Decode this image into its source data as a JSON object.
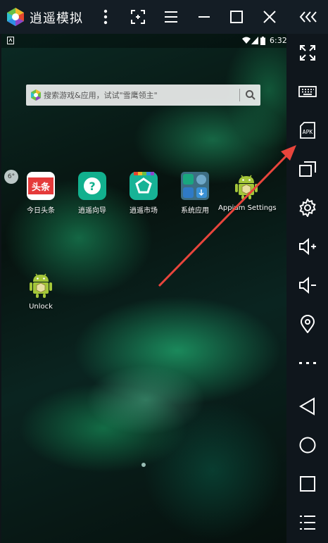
{
  "window": {
    "title": "逍遥模拟",
    "controls": [
      "menu-icon",
      "screenshot-icon",
      "list-icon",
      "minimize-icon",
      "maximize-icon",
      "close-icon",
      "collapse-icon"
    ]
  },
  "status_bar": {
    "time": "6:32",
    "icons": [
      "notification-icon",
      "wifi-icon",
      "signal-icon",
      "battery-icon"
    ]
  },
  "search": {
    "placeholder": "搜索游戏&应用，试试\"雪鹰领主\""
  },
  "weather": {
    "temperature": "6°"
  },
  "apps": [
    {
      "label": "今日头条",
      "icon_text": "头条",
      "icon": "toutiao-icon"
    },
    {
      "label": "逍遥向导",
      "icon_text": "?",
      "icon": "guide-icon"
    },
    {
      "label": "逍遥市场",
      "icon": "market-icon"
    },
    {
      "label": "系统应用",
      "icon": "system-apps-folder-icon"
    },
    {
      "label": "Appium Settings",
      "icon": "android-icon"
    },
    {
      "label": "Unlock",
      "icon": "android-icon"
    }
  ],
  "sidebar": {
    "buttons": [
      {
        "name": "fullscreen-icon"
      },
      {
        "name": "keyboard-icon"
      },
      {
        "name": "apk-install-icon",
        "label": "APK"
      },
      {
        "name": "multi-window-icon"
      },
      {
        "name": "settings-icon"
      },
      {
        "name": "volume-up-icon"
      },
      {
        "name": "volume-down-icon"
      },
      {
        "name": "location-icon"
      },
      {
        "name": "more-icon"
      },
      {
        "name": "back-icon"
      },
      {
        "name": "home-icon"
      },
      {
        "name": "recents-icon"
      },
      {
        "name": "menu-list-icon"
      }
    ]
  },
  "colors": {
    "titlebar_bg": "#141d25",
    "sidebar_bg": "#0f161c",
    "arrow": "#e8453c",
    "icon_white": "#ffffff"
  }
}
